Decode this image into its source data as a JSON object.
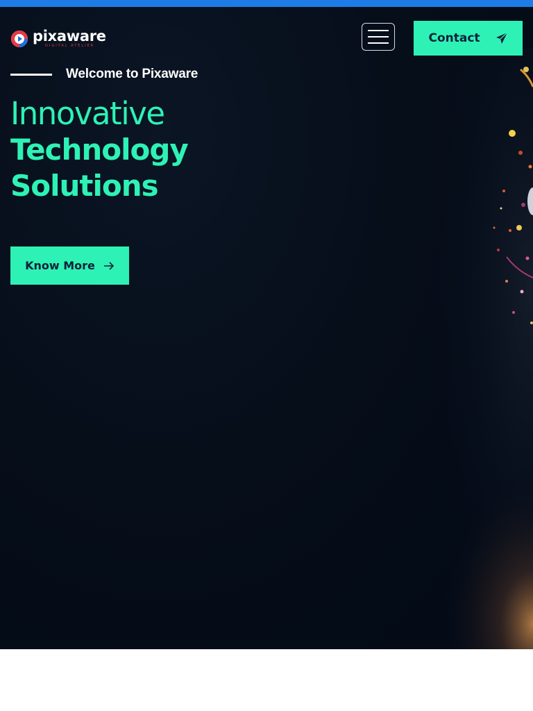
{
  "brand": {
    "name": "pixaware",
    "tagline": "DIGITAL ATELIER",
    "logo_colors": {
      "ring_red": "#e63946",
      "ring_blue": "#1e6fe0"
    }
  },
  "nav": {
    "menu_icon": "hamburger-menu-icon",
    "contact_label": "Contact",
    "contact_icon": "paper-plane-icon"
  },
  "hero": {
    "welcome": "Welcome to Pixaware",
    "headline_light": "Innovative",
    "headline_bold_line1": "Technology",
    "headline_bold_line2": "Solutions",
    "cta_label": "Know More",
    "cta_icon": "arrow-right-icon"
  },
  "colors": {
    "accent": "#2ef2b5",
    "top_strip": "#1e7ce6",
    "hero_background": "#030a16",
    "dark_text": "#11213a"
  }
}
